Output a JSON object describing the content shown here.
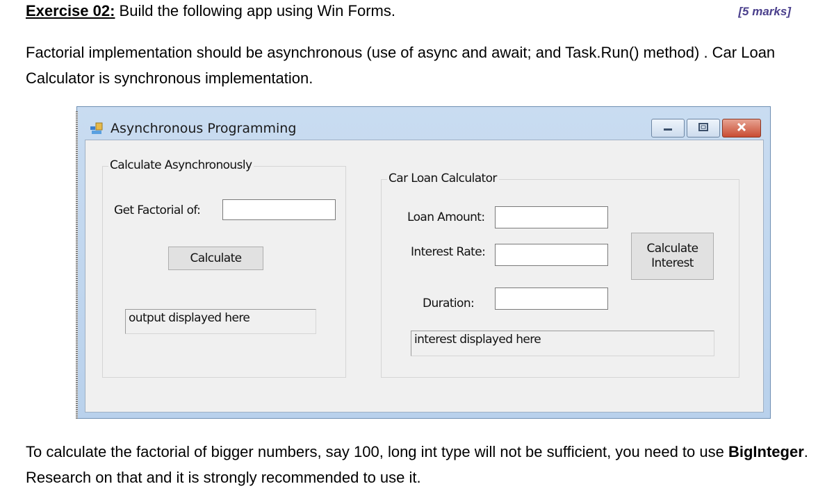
{
  "doc": {
    "heading_exercise": "Exercise 02:",
    "heading_rest": " Build the following app using Win Forms.",
    "marks": "[5 marks]",
    "paragraph1": "Factorial implementation should be asynchronous (use of async and await; and Task.Run() method) . Car Loan Calculator is synchronous implementation.",
    "paragraph2_bold": "BigInteger",
    "paragraph2_pre": "To calculate the factorial of bigger numbers, say 100, long int type will not be sufficient, you need to use ",
    "paragraph2_post": ". Research on that and it is strongly recommended to use it."
  },
  "window": {
    "title": "Asynchronous Programming",
    "icons": [
      "app-icon",
      "minimize-icon",
      "maximize-icon",
      "close-icon"
    ],
    "async_group": {
      "legend": "Calculate Asynchronously",
      "factorial_label": "Get Factorial of:",
      "factorial_value": "",
      "calculate_button": "Calculate",
      "output_text": "output displayed here"
    },
    "loan_group": {
      "legend": "Car Loan Calculator",
      "loan_amount_label": "Loan Amount:",
      "loan_amount_value": "",
      "interest_rate_label": "Interest Rate:",
      "interest_rate_value": "",
      "duration_label": "Duration:",
      "duration_value": "",
      "calculate_interest_button": "Calculate Interest",
      "interest_output_text": "interest displayed here"
    }
  },
  "colors": {
    "marks": "#4a3f8c",
    "title_bar": "#c9dcf1",
    "form_background": "#f0f0f0",
    "close_button": "#c94c33"
  }
}
